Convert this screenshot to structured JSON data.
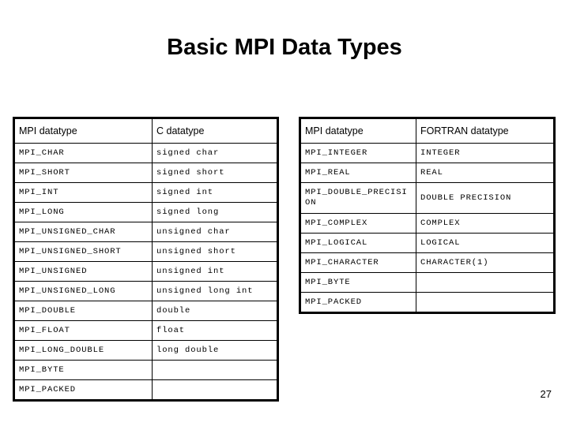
{
  "slide": {
    "title": "Basic MPI Data Types",
    "page_number": "27"
  },
  "tables": {
    "c_table": {
      "headers": [
        "MPI datatype",
        "C datatype"
      ],
      "rows": [
        [
          "MPI_CHAR",
          "signed char"
        ],
        [
          "MPI_SHORT",
          "signed short"
        ],
        [
          "MPI_INT",
          "signed int"
        ],
        [
          "MPI_LONG",
          "signed long"
        ],
        [
          "MPI_UNSIGNED_CHAR",
          "unsigned char"
        ],
        [
          "MPI_UNSIGNED_SHORT",
          "unsigned short"
        ],
        [
          "MPI_UNSIGNED",
          "unsigned int"
        ],
        [
          "MPI_UNSIGNED_LONG",
          "unsigned long int"
        ],
        [
          "MPI_DOUBLE",
          "double"
        ],
        [
          "MPI_FLOAT",
          "float"
        ],
        [
          "MPI_LONG_DOUBLE",
          "long double"
        ],
        [
          "MPI_BYTE",
          ""
        ],
        [
          "MPI_PACKED",
          ""
        ]
      ]
    },
    "fortran_table": {
      "headers": [
        "MPI datatype",
        "FORTRAN datatype"
      ],
      "rows": [
        [
          "MPI_INTEGER",
          "INTEGER"
        ],
        [
          "MPI_REAL",
          "REAL"
        ],
        [
          "MPI_DOUBLE_PRECISION",
          "DOUBLE PRECISION"
        ],
        [
          "MPI_COMPLEX",
          "COMPLEX"
        ],
        [
          "MPI_LOGICAL",
          "LOGICAL"
        ],
        [
          "MPI_CHARACTER",
          "CHARACTER(1)"
        ],
        [
          "MPI_BYTE",
          ""
        ],
        [
          "MPI_PACKED",
          ""
        ]
      ]
    }
  }
}
